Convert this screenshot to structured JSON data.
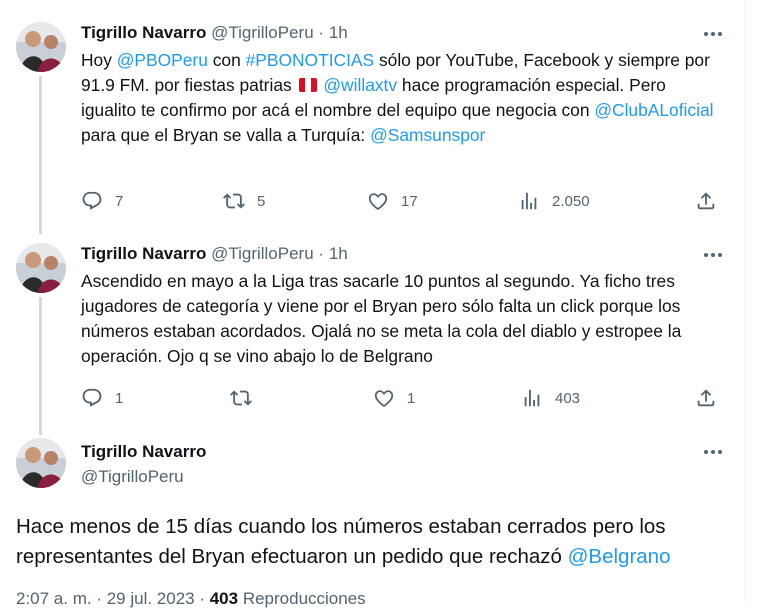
{
  "tweets": [
    {
      "name": "Tigrillo Navarro",
      "handle": "@TigrilloPeru",
      "sep": "·",
      "time": "1h",
      "text": {
        "t1": "Hoy ",
        "l1": "@PBOPeru",
        "t2": " con ",
        "l2": "#PBONOTICIAS",
        "t3": " sólo por YouTube, Facebook y siempre por 91.9 FM. por fiestas patrias ",
        "l3": "@willaxtv",
        "t4": " hace programación especial. Pero igualito te confirmo por acá el nombre del equipo que negocia con ",
        "l4": "@ClubALoficial",
        "t5": " para que el Bryan se valla a Turquía: ",
        "l5": "@Samsunspor"
      },
      "replies": "7",
      "retweets": "5",
      "likes": "17",
      "views": "2.050"
    },
    {
      "name": "Tigrillo Navarro",
      "handle": "@TigrilloPeru",
      "sep": "·",
      "time": "1h",
      "text": "Ascendido en mayo a la Liga tras sacarle 10 puntos al segundo. Ya ficho tres jugadores de categoría y viene por el Bryan pero sólo falta un click porque los números estaban acordados. Ojalá no se meta la cola del diablo y estropee la operación. Ojo q se vino abajo lo de Belgrano",
      "replies": "1",
      "retweets": "",
      "likes": "1",
      "views": "403"
    }
  ],
  "main_tweet": {
    "name": "Tigrillo Navarro",
    "handle": "@TigrilloPeru",
    "text_before": "Hace menos de 15 días cuando los números estaban cerrados pero los representantes del Bryan efectuaron un pedido que rechazó ",
    "link": "@Belgrano",
    "meta_time": "2:07 a. m. · 29 jul. 2023 · ",
    "meta_views": "403",
    "meta_views_label": " Reproducciones"
  },
  "colors": {
    "link": "#1d9bf0",
    "muted": "#536471",
    "text": "#0f1419",
    "thread": "#cfd9de"
  },
  "icons": [
    "reply-icon",
    "retweet-icon",
    "like-icon",
    "views-icon",
    "share-icon",
    "more-icon",
    "peru-flag-emoji"
  ]
}
